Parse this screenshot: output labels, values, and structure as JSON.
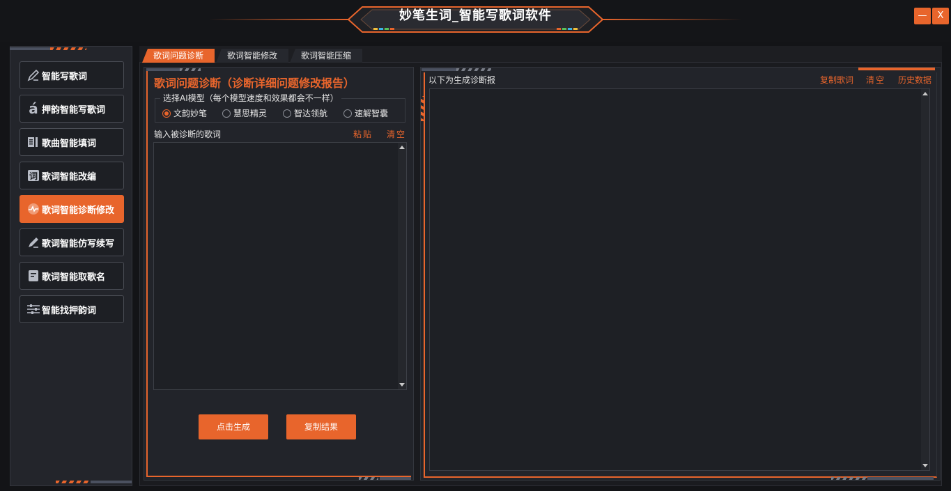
{
  "window": {
    "title": "妙笔生词_智能写歌词软件",
    "minimize_label": "—",
    "close_label": "X"
  },
  "sidebar": {
    "items": [
      {
        "label": "智能写歌词",
        "icon": "pen-icon",
        "active": false
      },
      {
        "label": "押韵智能写歌词",
        "icon": "accent-a-icon",
        "active": false
      },
      {
        "label": "歌曲智能填词",
        "icon": "list-icon",
        "active": false
      },
      {
        "label": "歌词智能改编",
        "icon": "word-box-icon",
        "active": false
      },
      {
        "label": "歌词智能诊断修改",
        "icon": "pulse-icon",
        "active": true
      },
      {
        "label": "歌词智能仿写续写",
        "icon": "pen-icon",
        "active": false
      },
      {
        "label": "歌词智能取歌名",
        "icon": "document-icon",
        "active": false
      },
      {
        "label": "智能找押韵词",
        "icon": "sliders-icon",
        "active": false
      }
    ]
  },
  "tabs": [
    {
      "label": "歌词问题诊断",
      "active": true
    },
    {
      "label": "歌词智能修改",
      "active": false
    },
    {
      "label": "歌词智能压缩",
      "active": false
    }
  ],
  "left_panel": {
    "title": "歌词问题诊断（诊断详细问题修改报告）",
    "model_group_label": "选择AI模型（每个模型速度和效果都会不一样）",
    "models": [
      {
        "label": "文韵妙笔",
        "selected": true
      },
      {
        "label": "慧思精灵",
        "selected": false
      },
      {
        "label": "智达领航",
        "selected": false
      },
      {
        "label": "速解智囊",
        "selected": false
      }
    ],
    "input_label": "输入被诊断的歌词",
    "paste_label": "粘贴",
    "clear_label": "清空",
    "input_value": "",
    "generate_button": "点击生成",
    "copy_result_button": "复制结果"
  },
  "right_panel": {
    "label": "以下为生成诊断报",
    "copy_lyrics_label": "复制歌词",
    "clear_label": "清空",
    "history_label": "历史数据",
    "output_value": ""
  },
  "colors": {
    "accent": "#e8652c",
    "background": "#131417",
    "panel": "#22242a"
  }
}
